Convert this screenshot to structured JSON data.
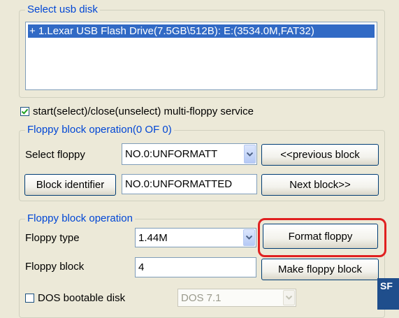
{
  "usb_group": {
    "legend": "Select usb disk",
    "items": [
      "+ 1.Lexar USB Flash Drive(7.5GB\\512B): E:(3534.0M,FAT32)"
    ]
  },
  "multi_floppy": {
    "checked": true,
    "label": "start(select)/close(unselect) multi-floppy service"
  },
  "block_group": {
    "legend": "Floppy block operation(0 OF 0)",
    "select_floppy_label": "Select floppy",
    "select_floppy_value": "NO.0:UNFORMATT",
    "previous_button": "<<previous block",
    "identifier_button": "Block identifier",
    "identifier_value": "NO.0:UNFORMATTED",
    "next_button": "Next block>>"
  },
  "op_group": {
    "legend": "Floppy block operation",
    "floppy_type_label": "Floppy type",
    "floppy_type_value": "1.44M",
    "format_button": "Format floppy",
    "floppy_block_label": "Floppy block",
    "floppy_block_value": "4",
    "make_button": "Make floppy block",
    "dos_checkbox_label": "DOS bootable disk",
    "dos_checked": false,
    "dos_version_value": "DOS 7.1"
  },
  "side_badge": "SF",
  "colors": {
    "background": "#ece9d8",
    "legend": "#0046d5",
    "selection": "#316ac5",
    "highlight": "#e02020"
  }
}
